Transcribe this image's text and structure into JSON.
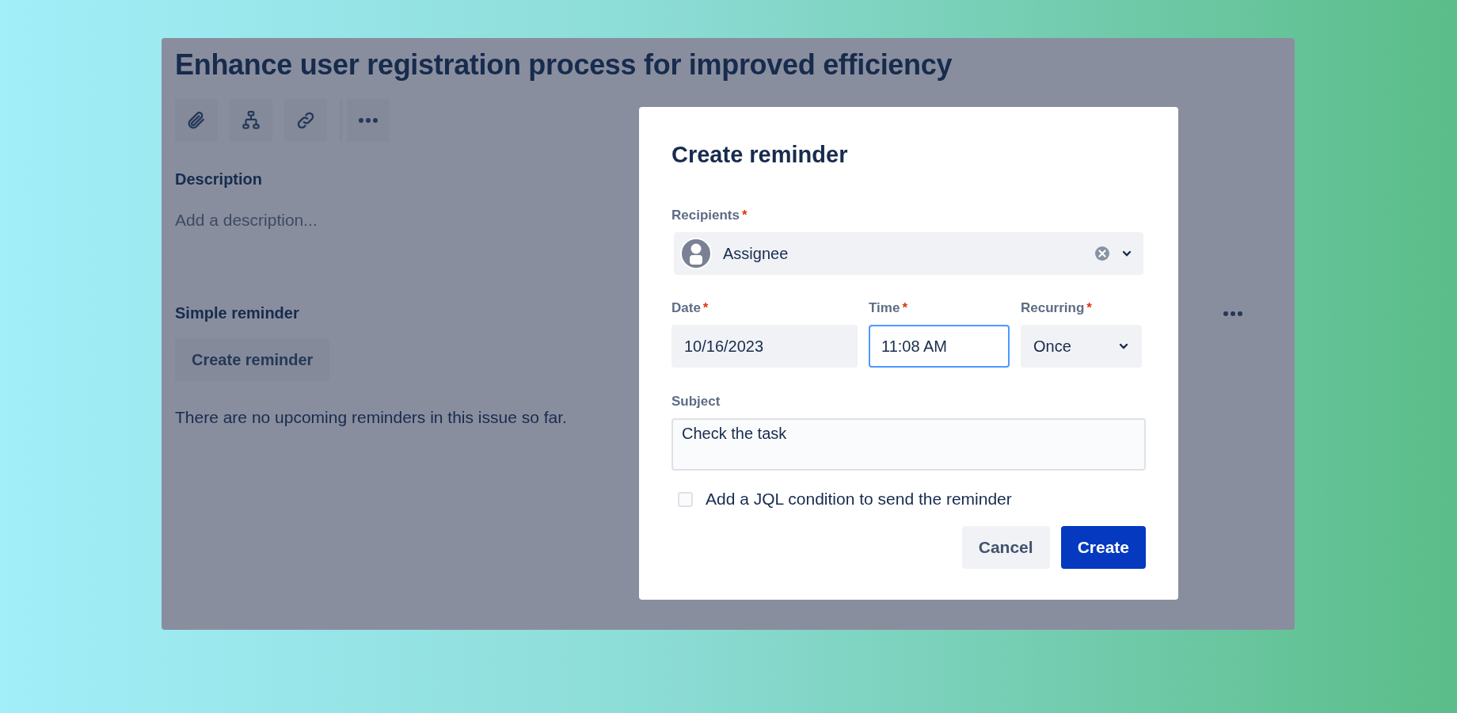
{
  "issue": {
    "title": "Enhance user registration process for improved efficiency",
    "toolbar": [
      {
        "kind": "attach"
      },
      {
        "kind": "hierarchy"
      },
      {
        "kind": "link"
      },
      {
        "kind": "more"
      }
    ],
    "description": {
      "heading": "Description",
      "placeholder": "Add a description..."
    },
    "reminders": {
      "heading": "Simple reminder",
      "button": "Create reminder",
      "empty_text": "There are no upcoming reminders in this issue so far."
    }
  },
  "dialog": {
    "title": "Create reminder",
    "recipients": {
      "label": "Recipients",
      "required": "*",
      "value": "Assignee"
    },
    "fields": [
      {
        "kind": "text",
        "label": "Date",
        "required": "*",
        "value": "10/16/2023",
        "focused": false
      },
      {
        "kind": "text",
        "label": "Time",
        "required": "*",
        "value": "11:08 AM",
        "focused": true
      },
      {
        "kind": "select",
        "label": "Recurring",
        "required": "*",
        "value": "Once",
        "focused": false
      }
    ],
    "subject": {
      "label": "Subject",
      "value": "Check the task"
    },
    "jql": {
      "label": "Add a JQL condition to send the reminder",
      "checked": false
    },
    "buttons": [
      {
        "label": "Cancel",
        "kind": "secondary"
      },
      {
        "label": "Create",
        "kind": "primary"
      }
    ]
  }
}
